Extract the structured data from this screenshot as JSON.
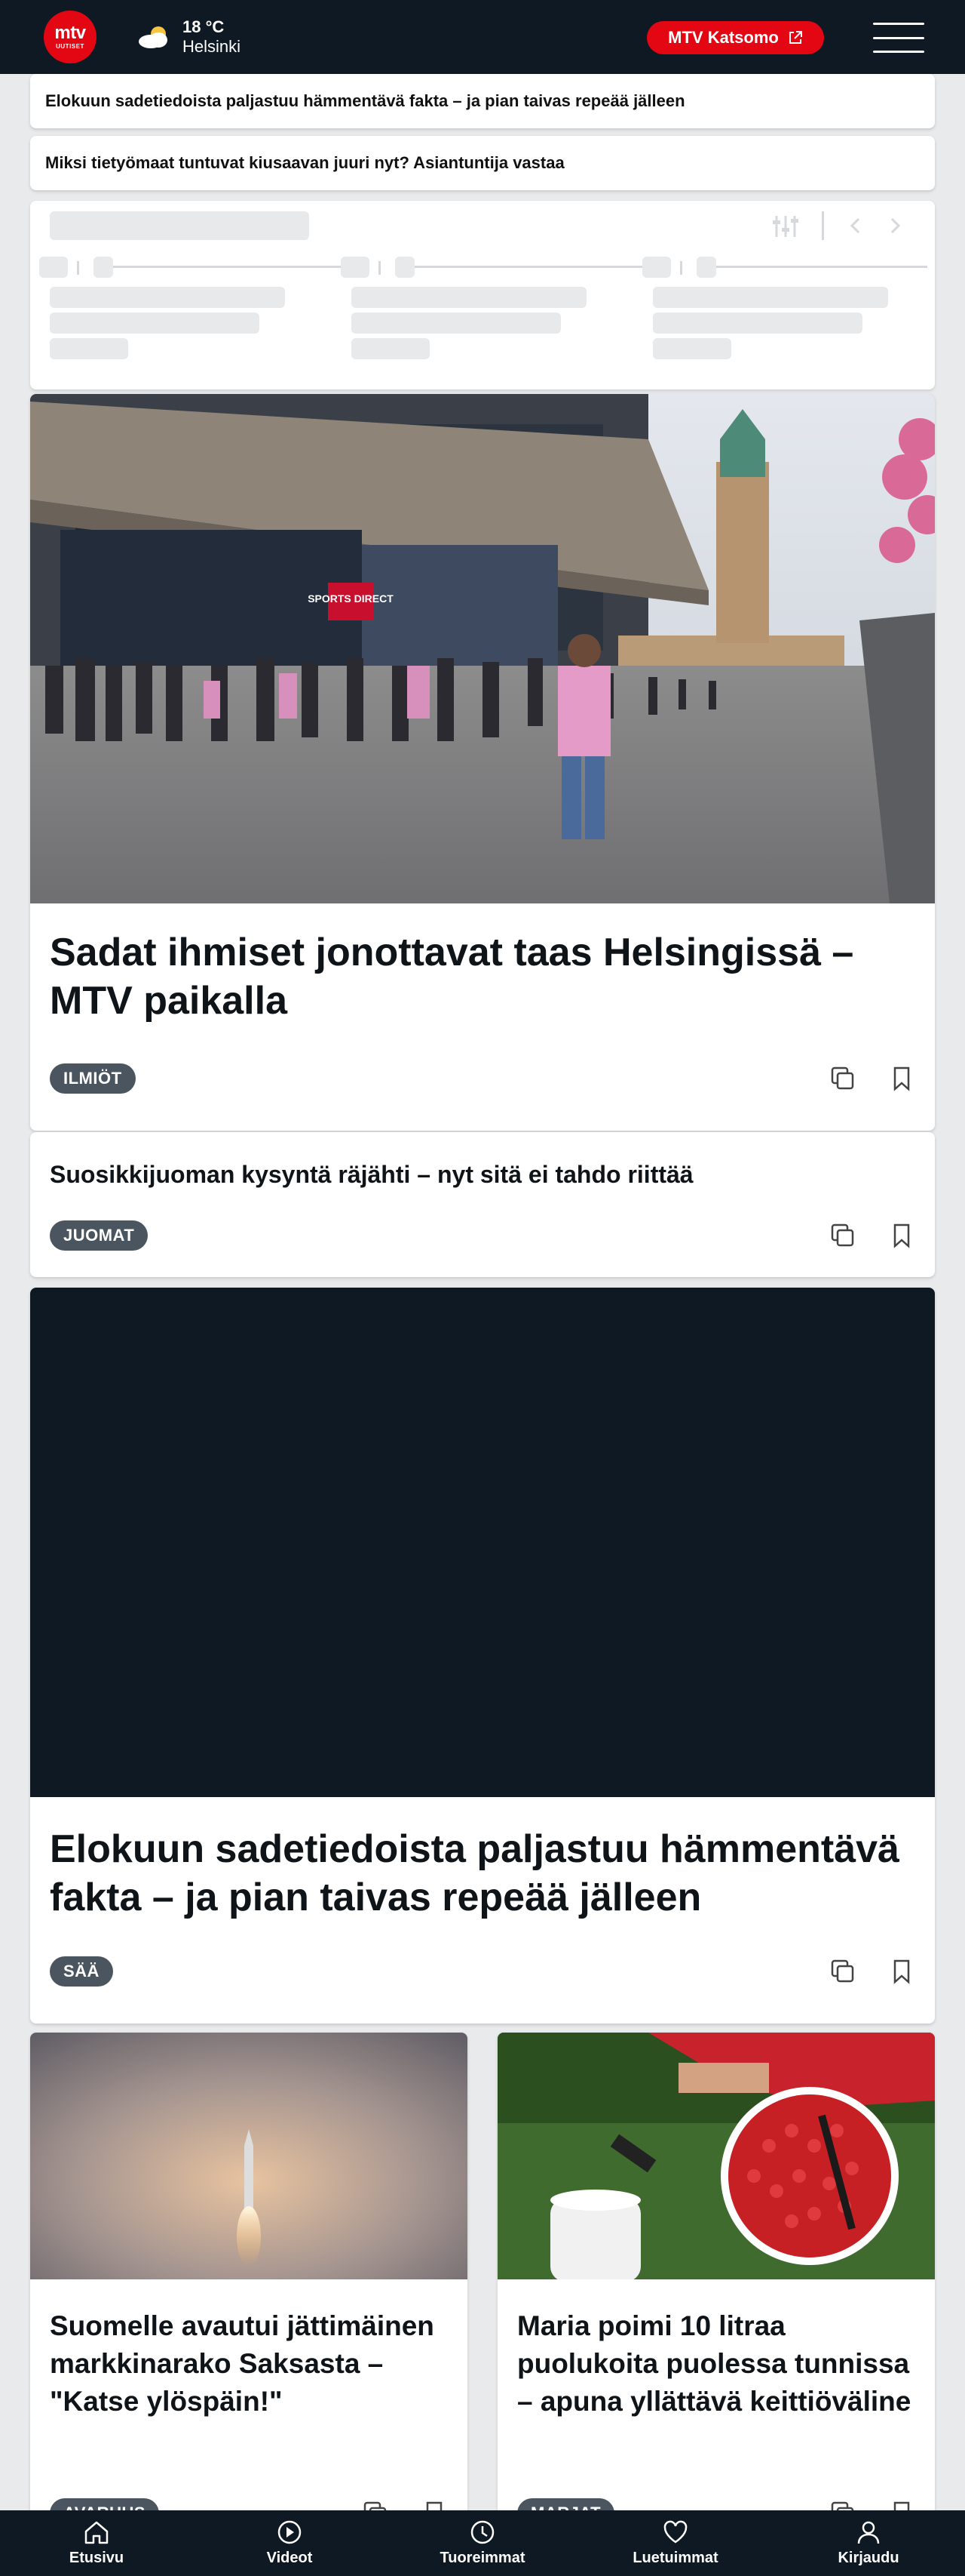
{
  "header": {
    "logo_top": "mtv",
    "logo_bottom": "UUTISET",
    "weather_icon": "partly-cloudy-icon",
    "temperature": "18 °C",
    "city": "Helsinki",
    "katsomo_label": "MTV Katsomo",
    "accent": "#e30613",
    "bg": "#0f1924"
  },
  "links": [
    {
      "text": "Elokuun sadetiedoista paljastuu hämmentävä fakta – ja pian taivas repeää jälleen"
    },
    {
      "text": "Miksi tietyömaat tuntuvat kiusaavan juuri nyt? Asiantuntija vastaa"
    }
  ],
  "articles": [
    {
      "title": "Sadat ihmiset jonottavat taas Helsingissä – MTV paikalla",
      "tag": "ILMIÖT",
      "sign": "SPORTS DIRECT"
    },
    {
      "title": "Suosikkijuoman kysyntä räjähti – nyt sitä ei tahdo riittää",
      "tag": "JUOMAT"
    },
    {
      "title": "Elokuun sadetiedoista paljastuu hämmentävä fakta – ja pian taivas repeää jälleen",
      "tag": "SÄÄ"
    }
  ],
  "grid": [
    {
      "title": "Suomelle avautui jättimäinen markkinarako Saksasta – \"Katse ylöspäin!\"",
      "tag": "AVARUUS"
    },
    {
      "title": "Maria poimi 10 litraa puolukoita puolessa tunnissa – apuna yllättävä keittiöväline",
      "tag": "MARJAT"
    }
  ],
  "nav": [
    {
      "label": "Etusivu",
      "icon": "home-icon"
    },
    {
      "label": "Videot",
      "icon": "play-icon"
    },
    {
      "label": "Tuoreimmat",
      "icon": "clock-icon"
    },
    {
      "label": "Luetuimmat",
      "icon": "heart-icon"
    },
    {
      "label": "Kirjaudu",
      "icon": "user-icon"
    }
  ]
}
